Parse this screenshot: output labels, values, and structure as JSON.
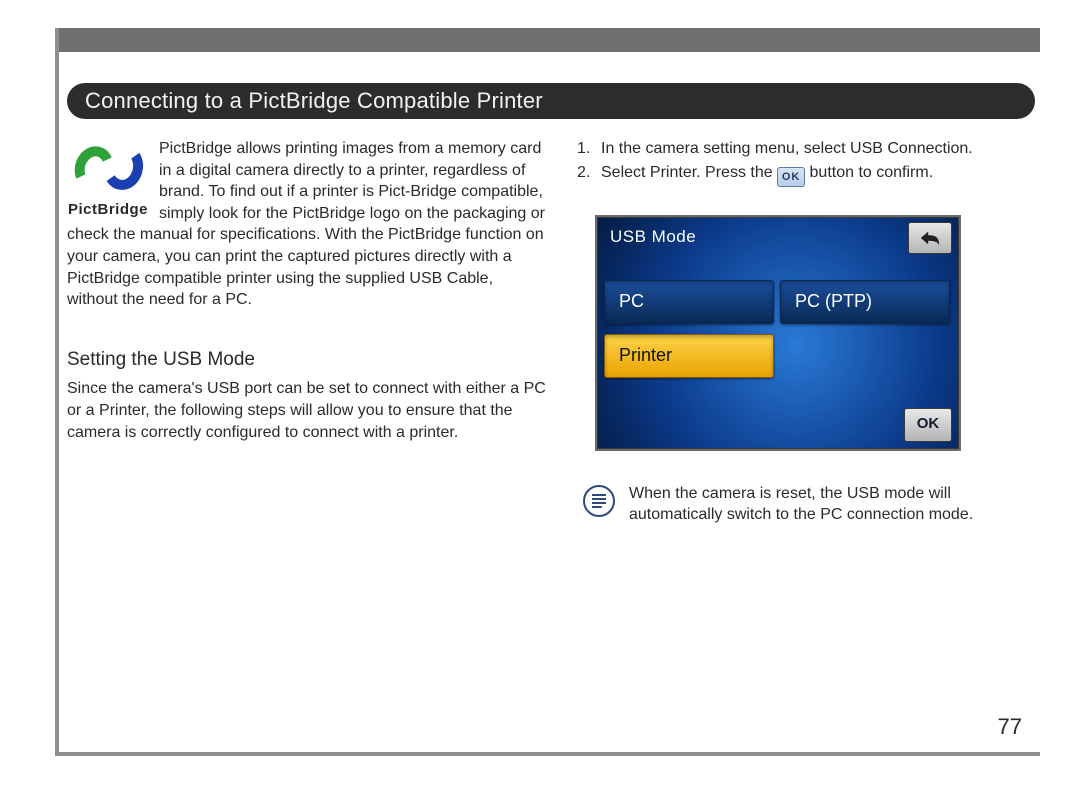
{
  "heading": "Connecting to a PictBridge Compatible Printer",
  "logo": {
    "label": "PictBridge"
  },
  "intro_text": "PictBridge allows printing images from a memory card in a digital camera directly to a printer, regardless of brand. To find out if a printer is Pict-Bridge compatible, simply look for the PictBridge logo on the packaging or check the manual for specifications. With the PictBridge function on your camera, you can print the captured pictures directly with a PictBridge compatible printer using the supplied USB Cable, without the need for a PC.",
  "subhead": "Setting the USB Mode",
  "usb_mode_para": "Since the camera's USB port can be set to connect with either a PC or a Printer, the following steps will allow you to ensure that the camera is correctly configured to connect with a printer.",
  "steps": {
    "s1_num": "1.",
    "s1_text": "In the camera setting menu, select USB Connection.",
    "s2_num": "2.",
    "s2_text_a": "Select Printer. Press the ",
    "s2_text_b": " button to confirm.",
    "ok_label": "OK"
  },
  "lcd": {
    "title": "USB Mode",
    "pc": "PC",
    "ptp": "PC (PTP)",
    "printer": "Printer",
    "ok": "OK"
  },
  "note_text": "When the camera is reset, the USB mode will automatically switch to the PC connection mode.",
  "page_number": "77"
}
